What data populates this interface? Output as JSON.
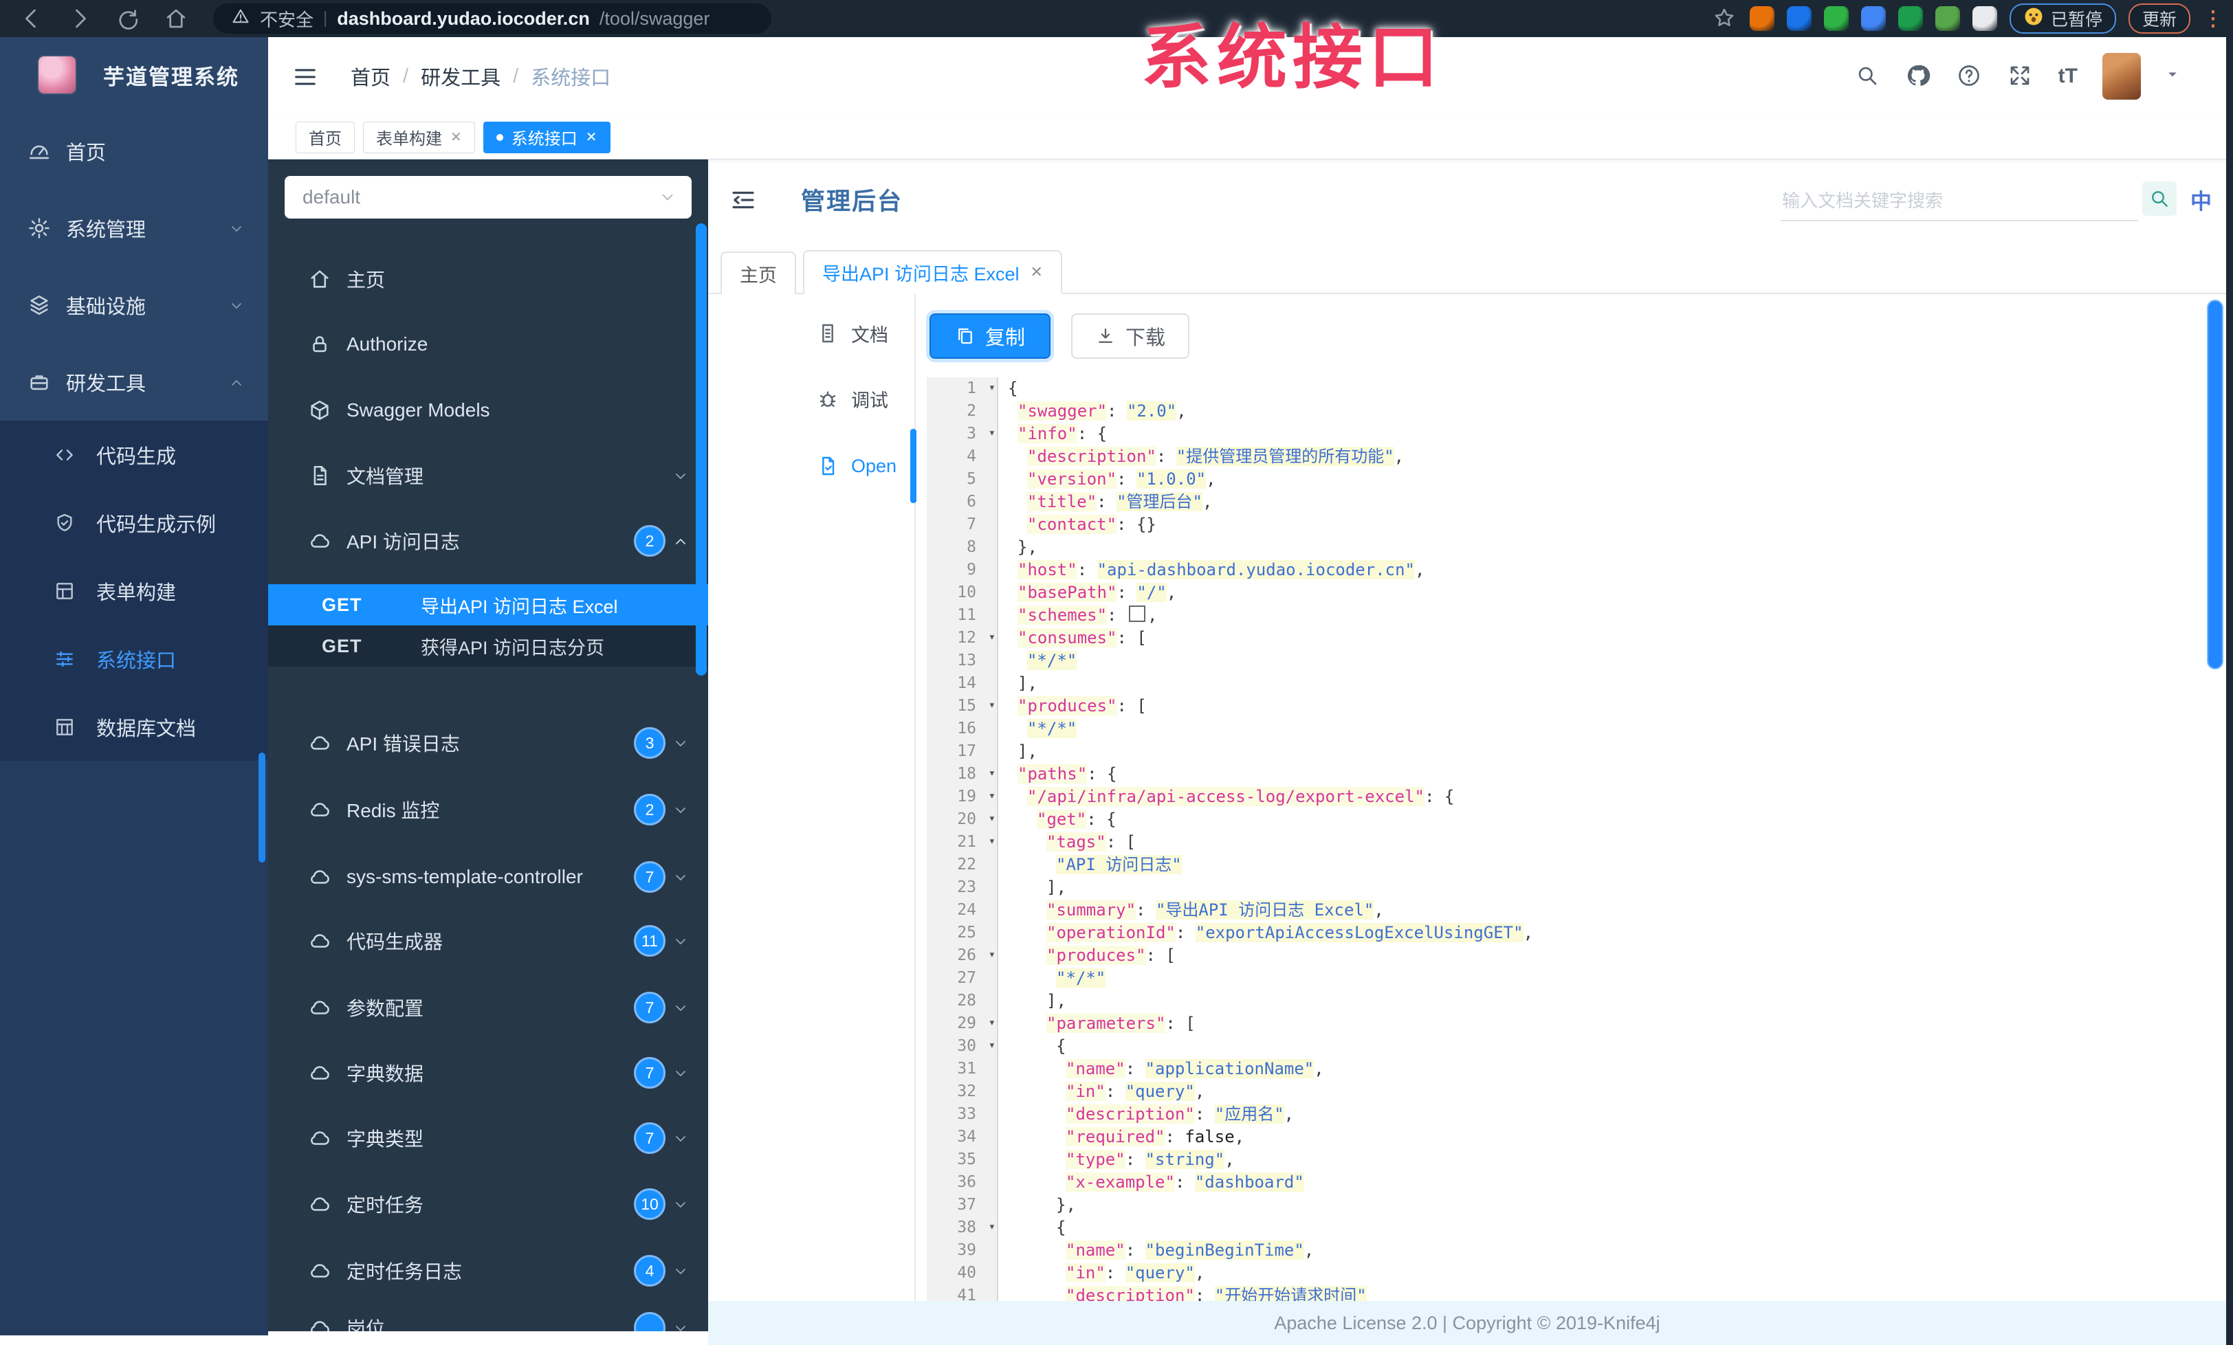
{
  "colors": {
    "accent": "#1890ff",
    "watermark_red": "#ee3b5f",
    "sidebar_navy": "#253c5f",
    "doc_sidebar_slate": "#263748",
    "badge_blue": "#1890ff"
  },
  "browser": {
    "nav": [
      {
        "name": "back-icon"
      },
      {
        "name": "forward-icon"
      },
      {
        "name": "reload-icon"
      },
      {
        "name": "home-icon"
      }
    ],
    "security_label": "不安全",
    "url_host": "dashboard.yudao.iocoder.cn",
    "url_path": "/tool/swagger",
    "extensions": [
      {
        "name": "extension-orange-icon",
        "color": "#e8710a"
      },
      {
        "name": "extension-blue-drop-icon",
        "color": "#1a73e8"
      },
      {
        "name": "extension-green-circle-icon",
        "color": "#2fb344"
      },
      {
        "name": "extension-blue-grid-icon",
        "color": "#4285f4"
      },
      {
        "name": "extension-git-icon",
        "color": "#1c9e4e"
      },
      {
        "name": "extension-leaf-icon",
        "color": "#57a64a"
      },
      {
        "name": "extension-puzzle-icon",
        "color": "#e8eaed"
      }
    ],
    "paused_label": "已暂停",
    "update_label": "更新"
  },
  "watermark": "系统接口",
  "sidebar": {
    "logo_title": "芋道管理系统",
    "menu": [
      {
        "label": "首页",
        "icon": "dashboard-icon"
      },
      {
        "label": "系统管理",
        "icon": "gear-icon",
        "chevron": "down"
      },
      {
        "label": "基础设施",
        "icon": "stack-icon",
        "chevron": "down"
      },
      {
        "label": "研发工具",
        "icon": "toolbox-icon",
        "chevron": "up"
      }
    ],
    "submenu": [
      {
        "label": "代码生成",
        "icon": "code-icon"
      },
      {
        "label": "代码生成示例",
        "icon": "shield-check-icon"
      },
      {
        "label": "表单构建",
        "icon": "form-grid-icon"
      },
      {
        "label": "系统接口",
        "icon": "interface-icon",
        "active": true
      },
      {
        "label": "数据库文档",
        "icon": "table-icon"
      }
    ]
  },
  "header": {
    "breadcrumb": [
      "首页",
      "研发工具",
      "系统接口"
    ],
    "separator": "/",
    "icons": [
      {
        "name": "search-icon"
      },
      {
        "name": "github-icon"
      },
      {
        "name": "question-icon"
      },
      {
        "name": "fullscreen-icon"
      }
    ],
    "font_size_label": "tT"
  },
  "tags": [
    {
      "label": "首页"
    },
    {
      "label": "表单构建",
      "closable": true
    },
    {
      "label": "系统接口",
      "closable": true,
      "active": true
    }
  ],
  "doc_sidebar": {
    "group_value": "default",
    "items": [
      {
        "label": "主页",
        "icon": "home-icon"
      },
      {
        "label": "Authorize",
        "icon": "lock-icon"
      },
      {
        "label": "Swagger Models",
        "icon": "cube-icon"
      },
      {
        "label": "文档管理",
        "icon": "file-icon",
        "chevron": "down"
      },
      {
        "label": "API 访问日志",
        "icon": "cloud-icon",
        "badge": "2",
        "chevron": "up"
      }
    ],
    "endpoints": [
      {
        "method": "GET",
        "label": "导出API 访问日志 Excel",
        "active": true
      },
      {
        "method": "GET",
        "label": "获得API 访问日志分页"
      }
    ],
    "controllers": [
      {
        "label": "API 错误日志",
        "badge": "3"
      },
      {
        "label": "Redis 监控",
        "badge": "2"
      },
      {
        "label": "sys-sms-template-controller",
        "badge": "7"
      },
      {
        "label": "代码生成器",
        "badge": "11"
      },
      {
        "label": "参数配置",
        "badge": "7"
      },
      {
        "label": "字典数据",
        "badge": "7"
      },
      {
        "label": "字典类型",
        "badge": "7"
      },
      {
        "label": "定时任务",
        "badge": "10"
      },
      {
        "label": "定时任务日志",
        "badge": "4"
      },
      {
        "label": "岗位",
        "badge": ""
      }
    ]
  },
  "content": {
    "title": "管理后台",
    "search_placeholder": "输入文档关键字搜索",
    "lang_label": "中",
    "tabs": [
      {
        "label": "主页"
      },
      {
        "label": "导出API 访问日志 Excel",
        "closable": true,
        "active": true
      }
    ],
    "panel_nav": [
      {
        "label": "文档",
        "icon": "doc-icon"
      },
      {
        "label": "调试",
        "icon": "bug-icon"
      },
      {
        "label": "Open",
        "icon": "open-file-icon",
        "active": true
      }
    ],
    "copy_label": "复制",
    "download_label": "下载",
    "footer": "Apache License 2.0 | Copyright © 2019-Knife4j"
  },
  "icons": {
    "fold": "▾",
    "close": "✕",
    "dots": "⋮",
    "caret": "▼"
  },
  "code_lines": [
    [
      1,
      1,
      0,
      [
        [
          "p",
          "{"
        ]
      ]
    ],
    [
      2,
      0,
      1,
      [
        [
          "k",
          "\"swagger\""
        ],
        [
          "p",
          ": "
        ],
        [
          "s",
          "\"2.0\""
        ],
        [
          "p",
          ","
        ]
      ]
    ],
    [
      3,
      1,
      1,
      [
        [
          "k",
          "\"info\""
        ],
        [
          "p",
          ": {"
        ]
      ]
    ],
    [
      4,
      0,
      2,
      [
        [
          "k",
          "\"description\""
        ],
        [
          "p",
          ": "
        ],
        [
          "s",
          "\"提供管理员管理的所有功能\""
        ],
        [
          "p",
          ","
        ]
      ]
    ],
    [
      5,
      0,
      2,
      [
        [
          "k",
          "\"version\""
        ],
        [
          "p",
          ": "
        ],
        [
          "s",
          "\"1.0.0\""
        ],
        [
          "p",
          ","
        ]
      ]
    ],
    [
      6,
      0,
      2,
      [
        [
          "k",
          "\"title\""
        ],
        [
          "p",
          ": "
        ],
        [
          "s",
          "\"管理后台\""
        ],
        [
          "p",
          ","
        ]
      ]
    ],
    [
      7,
      0,
      2,
      [
        [
          "k",
          "\"contact\""
        ],
        [
          "p",
          ": {}"
        ]
      ]
    ],
    [
      8,
      0,
      1,
      [
        [
          "p",
          "},"
        ]
      ]
    ],
    [
      9,
      0,
      1,
      [
        [
          "k",
          "\"host\""
        ],
        [
          "p",
          ": "
        ],
        [
          "s",
          "\"api-dashboard.yudao.iocoder.cn\""
        ],
        [
          "p",
          ","
        ]
      ]
    ],
    [
      10,
      0,
      1,
      [
        [
          "k",
          "\"basePath\""
        ],
        [
          "p",
          ": "
        ],
        [
          "s",
          "\"/\""
        ],
        [
          "p",
          ","
        ]
      ]
    ],
    [
      11,
      0,
      1,
      [
        [
          "k",
          "\"schemes\""
        ],
        [
          "p",
          ": "
        ],
        [
          "x",
          ""
        ],
        [
          "p",
          ","
        ]
      ]
    ],
    [
      12,
      1,
      1,
      [
        [
          "k",
          "\"consumes\""
        ],
        [
          "p",
          ": ["
        ]
      ]
    ],
    [
      13,
      0,
      2,
      [
        [
          "s",
          "\"*/*\""
        ]
      ]
    ],
    [
      14,
      0,
      1,
      [
        [
          "p",
          "],"
        ]
      ]
    ],
    [
      15,
      1,
      1,
      [
        [
          "k",
          "\"produces\""
        ],
        [
          "p",
          ": ["
        ]
      ]
    ],
    [
      16,
      0,
      2,
      [
        [
          "s",
          "\"*/*\""
        ]
      ]
    ],
    [
      17,
      0,
      1,
      [
        [
          "p",
          "],"
        ]
      ]
    ],
    [
      18,
      1,
      1,
      [
        [
          "k",
          "\"paths\""
        ],
        [
          "p",
          ": {"
        ]
      ]
    ],
    [
      19,
      1,
      2,
      [
        [
          "k",
          "\"/api/infra/api-access-log/export-excel\""
        ],
        [
          "p",
          ": {"
        ]
      ]
    ],
    [
      20,
      1,
      3,
      [
        [
          "k",
          "\"get\""
        ],
        [
          "p",
          ": {"
        ]
      ]
    ],
    [
      21,
      1,
      4,
      [
        [
          "k",
          "\"tags\""
        ],
        [
          "p",
          ": ["
        ]
      ]
    ],
    [
      22,
      0,
      5,
      [
        [
          "s",
          "\"API 访问日志\""
        ]
      ]
    ],
    [
      23,
      0,
      4,
      [
        [
          "p",
          "],"
        ]
      ]
    ],
    [
      24,
      0,
      4,
      [
        [
          "k",
          "\"summary\""
        ],
        [
          "p",
          ": "
        ],
        [
          "s",
          "\"导出API 访问日志 Excel\""
        ],
        [
          "p",
          ","
        ]
      ]
    ],
    [
      25,
      0,
      4,
      [
        [
          "k",
          "\"operationId\""
        ],
        [
          "p",
          ": "
        ],
        [
          "s",
          "\"exportApiAccessLogExcelUsingGET\""
        ],
        [
          "p",
          ","
        ]
      ]
    ],
    [
      26,
      1,
      4,
      [
        [
          "k",
          "\"produces\""
        ],
        [
          "p",
          ": ["
        ]
      ]
    ],
    [
      27,
      0,
      5,
      [
        [
          "s",
          "\"*/*\""
        ]
      ]
    ],
    [
      28,
      0,
      4,
      [
        [
          "p",
          "],"
        ]
      ]
    ],
    [
      29,
      1,
      4,
      [
        [
          "k",
          "\"parameters\""
        ],
        [
          "p",
          ": ["
        ]
      ]
    ],
    [
      30,
      1,
      5,
      [
        [
          "p",
          "{"
        ]
      ]
    ],
    [
      31,
      0,
      6,
      [
        [
          "k",
          "\"name\""
        ],
        [
          "p",
          ": "
        ],
        [
          "s",
          "\"applicationName\""
        ],
        [
          "p",
          ","
        ]
      ]
    ],
    [
      32,
      0,
      6,
      [
        [
          "k",
          "\"in\""
        ],
        [
          "p",
          ": "
        ],
        [
          "s",
          "\"query\""
        ],
        [
          "p",
          ","
        ]
      ]
    ],
    [
      33,
      0,
      6,
      [
        [
          "k",
          "\"description\""
        ],
        [
          "p",
          ": "
        ],
        [
          "s",
          "\"应用名\""
        ],
        [
          "p",
          ","
        ]
      ]
    ],
    [
      34,
      0,
      6,
      [
        [
          "k",
          "\"required\""
        ],
        [
          "p",
          ": "
        ],
        [
          "b",
          "false"
        ],
        [
          "p",
          ","
        ]
      ]
    ],
    [
      35,
      0,
      6,
      [
        [
          "k",
          "\"type\""
        ],
        [
          "p",
          ": "
        ],
        [
          "s",
          "\"string\""
        ],
        [
          "p",
          ","
        ]
      ]
    ],
    [
      36,
      0,
      6,
      [
        [
          "k",
          "\"x-example\""
        ],
        [
          "p",
          ": "
        ],
        [
          "s",
          "\"dashboard\""
        ]
      ]
    ],
    [
      37,
      0,
      5,
      [
        [
          "p",
          "},"
        ]
      ]
    ],
    [
      38,
      1,
      5,
      [
        [
          "p",
          "{"
        ]
      ]
    ],
    [
      39,
      0,
      6,
      [
        [
          "k",
          "\"name\""
        ],
        [
          "p",
          ": "
        ],
        [
          "s",
          "\"beginBeginTime\""
        ],
        [
          "p",
          ","
        ]
      ]
    ],
    [
      40,
      0,
      6,
      [
        [
          "k",
          "\"in\""
        ],
        [
          "p",
          ": "
        ],
        [
          "s",
          "\"query\""
        ],
        [
          "p",
          ","
        ]
      ]
    ],
    [
      41,
      0,
      6,
      [
        [
          "k",
          "\"description\""
        ],
        [
          "p",
          ": "
        ],
        [
          "s",
          "\"开始开始请求时间\""
        ]
      ]
    ]
  ]
}
